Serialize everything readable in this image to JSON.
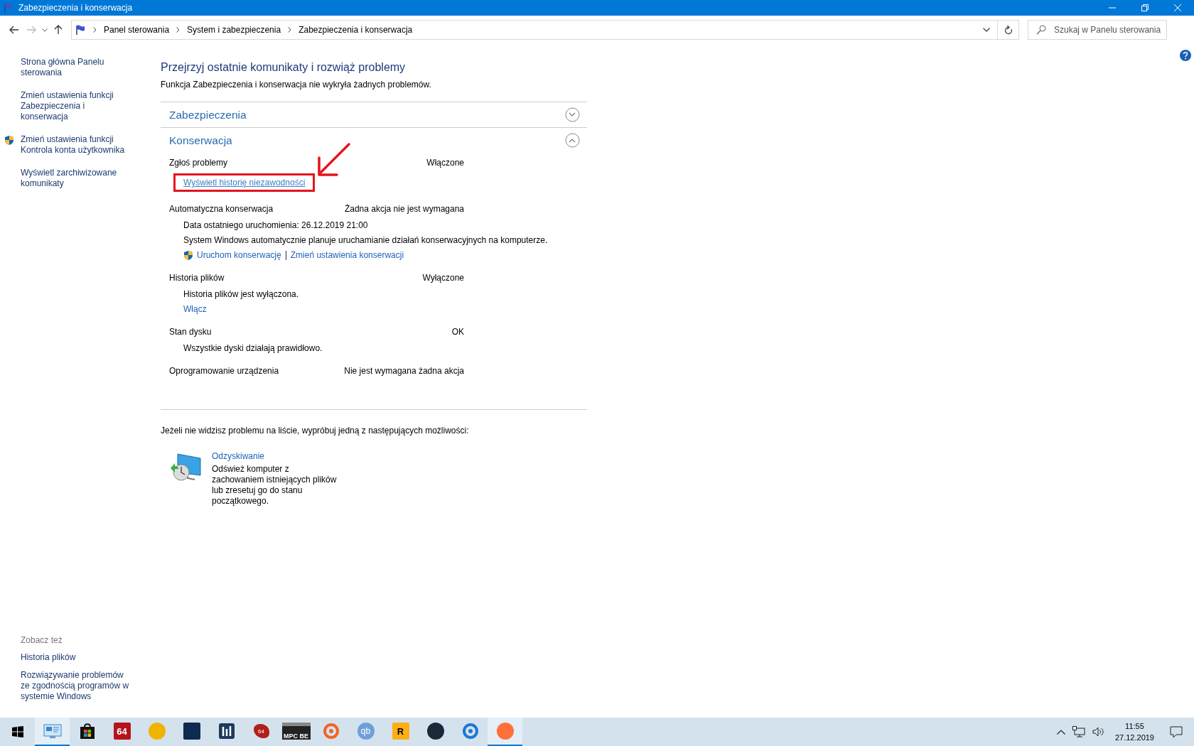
{
  "window": {
    "title": "Zabezpieczenia i konserwacja"
  },
  "address_bar": {
    "breadcrumbs": [
      "Panel sterowania",
      "System i zabezpieczenia",
      "Zabezpieczenia i konserwacja"
    ],
    "search_placeholder": "Szukaj w Panelu sterowania"
  },
  "sidebar": {
    "links": [
      {
        "text": "Strona główna Panelu sterowania",
        "shield": false
      },
      {
        "text": "Zmień ustawienia funkcji Zabezpieczenia i konserwacja",
        "shield": false
      },
      {
        "text": "Zmień ustawienia funkcji Kontrola konta użytkownika",
        "shield": true
      },
      {
        "text": "Wyświetl zarchiwizowane komunikaty",
        "shield": false
      }
    ],
    "see_also": {
      "heading": "Zobacz też",
      "links": [
        {
          "text": "Historia plików",
          "shield": false
        },
        {
          "text": "Rozwiązywanie problemów ze zgodnością programów w systemie Windows",
          "shield": false
        }
      ]
    }
  },
  "main": {
    "heading": "Przejrzyj ostatnie komunikaty i rozwiąż problemy",
    "subtitle": "Funkcja Zabezpieczenia i konserwacja nie wykryła żadnych problemów.",
    "sections": [
      {
        "title": "Zabezpieczenia",
        "expanded": false
      },
      {
        "title": "Konserwacja",
        "expanded": true,
        "items": [
          {
            "label": "Zgłoś problemy",
            "status": "Włączone",
            "details": [
              {
                "kind": "link",
                "text": "Wyświetl historię niezawodności",
                "annotated": true
              }
            ]
          },
          {
            "label": "Automatyczna konserwacja",
            "status": "Żadna akcja nie jest wymagana",
            "details": [
              {
                "kind": "text",
                "text": "Data ostatniego uruchomienia: 26.12.2019 21:00"
              },
              {
                "kind": "text",
                "text": "System Windows automatycznie planuje uruchamianie działań konserwacyjnych na komputerze."
              },
              {
                "kind": "actions",
                "links": [
                  {
                    "text": "Uruchom konserwację",
                    "shield": true
                  },
                  {
                    "text": "Zmień ustawienia konserwacji",
                    "shield": false
                  }
                ]
              }
            ]
          },
          {
            "label": "Historia plików",
            "status": "Wyłączone",
            "details": [
              {
                "kind": "text",
                "text": "Historia plików jest wyłączona."
              },
              {
                "kind": "link",
                "text": "Włącz",
                "annotated": false
              }
            ]
          },
          {
            "label": "Stan dysku",
            "status": "OK",
            "details": [
              {
                "kind": "text",
                "text": "Wszystkie dyski działają prawidłowo."
              }
            ]
          },
          {
            "label": "Oprogramowanie urządzenia",
            "status": "Nie jest wymagana żadna akcja"
          }
        ]
      }
    ],
    "hint": "Jeżeli nie widzisz problemu na liście, wypróbuj jedną z następujących możliwości:",
    "recovery": {
      "title": "Odzyskiwanie",
      "description": "Odśwież komputer z zachowaniem istniejących plików lub zresetuj go do stanu początkowego."
    }
  },
  "taskbar": {
    "apps": [
      {
        "kind": "panel",
        "active": true
      },
      {
        "kind": "bag",
        "active": false
      },
      {
        "kind": "tile",
        "color": "#b3151b",
        "glyph": "64",
        "active": false
      },
      {
        "kind": "circle",
        "color": "#f0b400",
        "active": false
      },
      {
        "kind": "tile",
        "color": "#0d2b4e",
        "active": false
      },
      {
        "kind": "bars",
        "color": "#1d3a5c",
        "active": false
      },
      {
        "kind": "splat",
        "color": "#b0201a",
        "glyph": "64",
        "active": false
      },
      {
        "kind": "clapper",
        "color": "#222222",
        "glyph": "MPC BE",
        "active": false
      },
      {
        "kind": "ring",
        "color": "#f26522",
        "active": false
      },
      {
        "kind": "circle",
        "color": "#6f9fd8",
        "glyph": "qb",
        "active": false
      },
      {
        "kind": "tile",
        "color": "#fcaf17",
        "glyph": "R",
        "active": false
      },
      {
        "kind": "circle",
        "color": "#1b2838",
        "active": false
      },
      {
        "kind": "ring",
        "color": "#1c78d6",
        "active": false
      },
      {
        "kind": "circle",
        "color": "#ff7139",
        "active": true
      }
    ],
    "time": "11:55",
    "date": "27.12.2019"
  }
}
